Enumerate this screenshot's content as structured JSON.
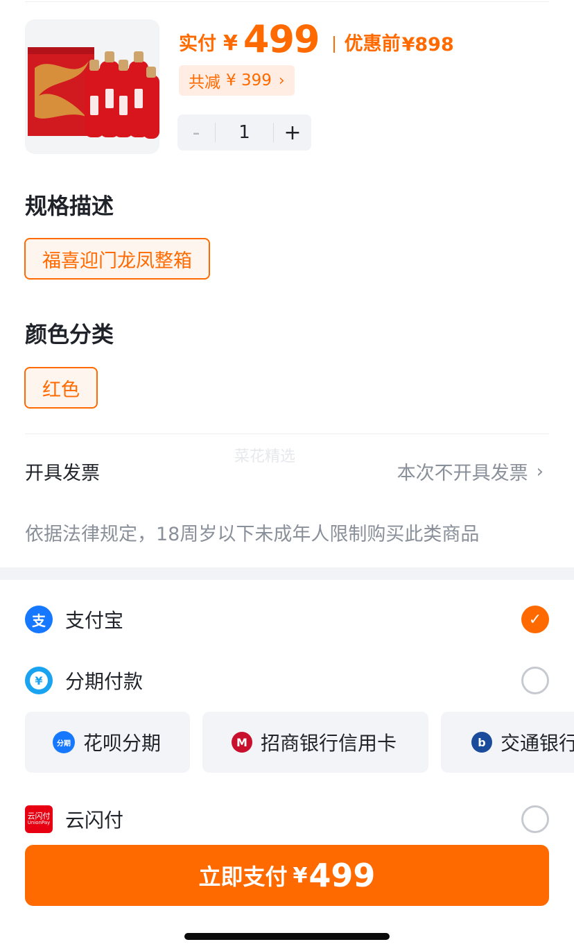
{
  "product": {
    "image_alt": "五粮液福喜迎门龙凤整箱",
    "pay_label": "实付",
    "currency": "¥",
    "pay_amount": "499",
    "original_label": "优惠前",
    "original_price": "¥898",
    "discount_label": "共减",
    "discount_amount": "¥ 399",
    "quantity": "1",
    "minus": "-",
    "plus": "+"
  },
  "spec": {
    "title": "规格描述",
    "selected": "福喜迎门龙凤整箱"
  },
  "color": {
    "title": "颜色分类",
    "selected": "红色"
  },
  "watermark": "菜花精选",
  "invoice": {
    "label": "开具发票",
    "value": "本次不开具发票"
  },
  "legal_note": "依据法律规定，18周岁以下未成年人限制购买此类商品",
  "payment": {
    "alipay": {
      "label": "支付宝",
      "icon": "alipay-icon",
      "icon_glyph": "支",
      "selected": true
    },
    "installment": {
      "label": "分期付款",
      "icon": "installment-icon",
      "icon_glyph": "¥",
      "selected": false
    },
    "installment_options": [
      {
        "label": "花呗分期",
        "icon": "huabei-icon",
        "glyph": "分期"
      },
      {
        "label": "招商银行信用卡",
        "icon": "cmb-icon",
        "glyph": "M"
      },
      {
        "label": "交通银行",
        "icon": "bocom-icon",
        "glyph": "b"
      }
    ],
    "unionpay": {
      "label": "云闪付",
      "icon": "yunshanfu-icon",
      "icon_text_top": "云闪付",
      "icon_text_bottom": "UnionPay",
      "selected": false
    }
  },
  "pay_button": {
    "label": "立即支付",
    "currency": "¥",
    "amount": "499"
  },
  "colors": {
    "accent": "#ff6a00",
    "alipay_blue": "#1677ff",
    "installment_blue": "#1aa3f0",
    "cmb_red": "#c8102e",
    "bocom_blue": "#1b4b9b"
  }
}
